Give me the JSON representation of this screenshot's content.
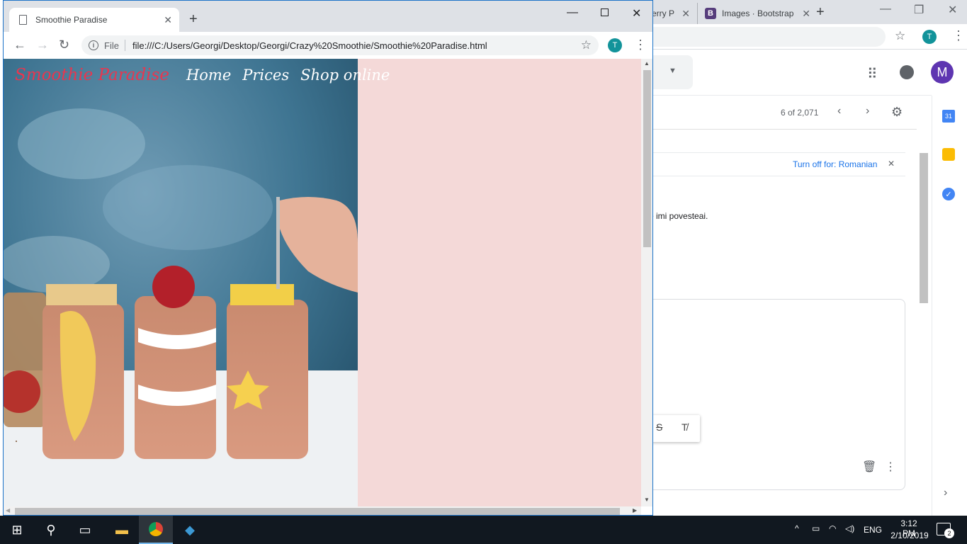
{
  "background_window": {
    "tabs": [
      {
        "label": "erry P",
        "closable": true
      },
      {
        "label": "Images · Bootstrap",
        "icon": "bootstrap-icon",
        "closable": true
      }
    ],
    "profile_initial": "T",
    "gmail": {
      "account_initial": "M",
      "pager": "6 of 2,071",
      "translate_link": "Turn off for: Romanian",
      "message_fragment": "e imi povesteai.",
      "side_icons": [
        "calendar-icon",
        "keep-icon",
        "tasks-icon"
      ],
      "calendar_day": "31"
    }
  },
  "foreground_window": {
    "tab_title": "Smoothie Paradise",
    "address": {
      "scheme_label": "File",
      "url": "file:///C:/Users/Georgi/Desktop/Georgi/Crazy%20Smoothie/Smoothie%20Paradise.html"
    },
    "profile_initial": "T"
  },
  "page": {
    "brand": "Smoothie Paradise",
    "nav": [
      "Home",
      "Prices",
      "Shop online"
    ],
    "colors": {
      "brand": "#e8364f",
      "panel": "#f4d9d8"
    }
  },
  "taskbar": {
    "language": "ENG",
    "time": "3:12 PM",
    "date": "2/10/2019",
    "notifications": "2",
    "apps": [
      "start-icon",
      "search-icon",
      "task-view-icon",
      "file-explorer-icon",
      "chrome-icon",
      "vscode-icon"
    ]
  }
}
